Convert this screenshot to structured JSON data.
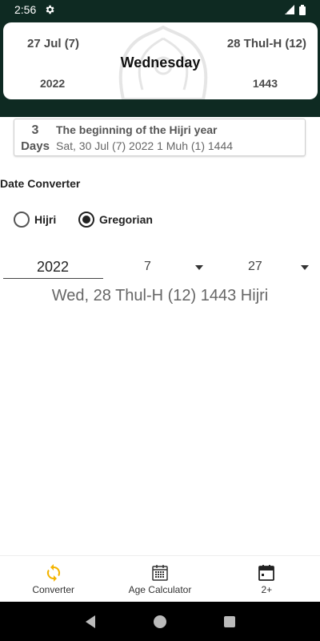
{
  "status_bar": {
    "time": "2:56"
  },
  "header": {
    "gregorian_day": "27 Jul (7)",
    "hijri_day": "28 Thul-H (12)",
    "weekday": "Wednesday",
    "gregorian_year": "2022",
    "hijri_year": "1443"
  },
  "event": {
    "count": "3",
    "unit": "Days",
    "title": "The beginning of the Hijri year",
    "date": "Sat, 30 Jul (7) 2022 1 Muh (1) 1444"
  },
  "converter": {
    "title": "Date Converter",
    "radio_hijri": "Hijri",
    "radio_gregorian": "Gregorian",
    "selected": "Gregorian",
    "year": "2022",
    "month": "7",
    "day": "27",
    "result": "Wed, 28 Thul-H (12) 1443 Hijri"
  },
  "bottom_nav": {
    "converter": "Converter",
    "age_calculator": "Age Calculator",
    "more": "2+"
  },
  "colors": {
    "header_bg": "#0e2a22",
    "active_icon": "#f4b400"
  }
}
